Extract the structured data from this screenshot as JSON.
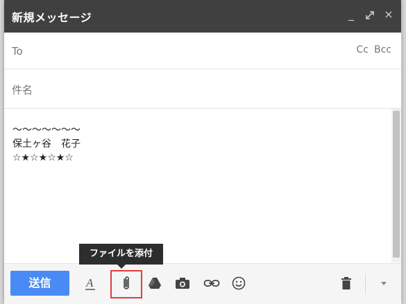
{
  "window": {
    "title": "新規メッセージ",
    "controls": {
      "minimize": "_",
      "expand": "↗",
      "close": "×"
    }
  },
  "fields": {
    "to_label": "To",
    "cc_label": "Cc",
    "bcc_label": "Bcc",
    "subject_placeholder": "件名"
  },
  "body_lines": [
    "～～～～～～～",
    "保土ヶ谷　花子",
    "☆★☆★☆★☆"
  ],
  "toolbar": {
    "send_label": "送信",
    "icons": [
      "text-format-icon",
      "paperclip-icon",
      "drive-icon",
      "photo-icon",
      "link-icon",
      "emoji-icon",
      "trash-icon",
      "more-options-icon"
    ]
  },
  "tooltip": {
    "text": "ファイルを添付"
  },
  "colors": {
    "titlebar": "#404040",
    "send_button": "#4a8af4",
    "highlight": "#e23b3b"
  }
}
